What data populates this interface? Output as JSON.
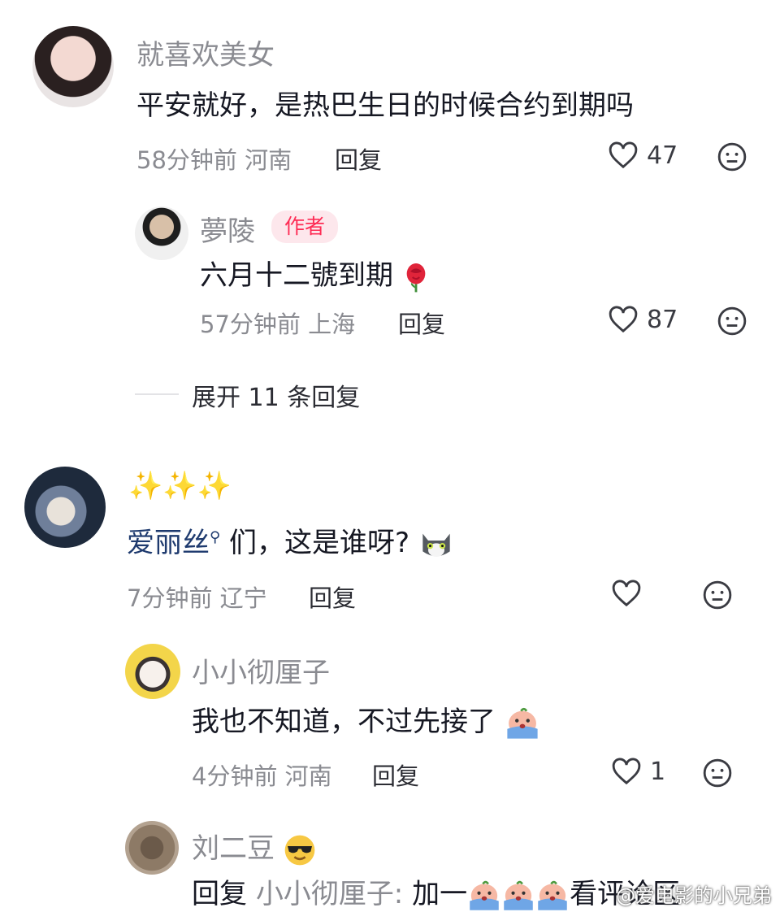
{
  "comments": [
    {
      "username": "就喜欢美女",
      "text": "平安就好，是热巴生日的时候合约到期吗",
      "time_location": "58分钟前 河南",
      "reply_label": "回复",
      "likes": "47"
    },
    {
      "username": "夢陵",
      "badge": "作者",
      "text": "六月十二號到期",
      "time_location": "57分钟前 上海",
      "reply_label": "回复",
      "likes": "87"
    },
    {
      "username": "✨✨✨",
      "mention": "爱丽丝",
      "text": "们，这是谁呀?",
      "time_location": "7分钟前 辽宁",
      "reply_label": "回复",
      "likes": ""
    },
    {
      "username": "小小彻厘子",
      "text": "我也不知道，不过先接了",
      "time_location": "4分钟前 河南",
      "reply_label": "回复",
      "likes": "1"
    },
    {
      "username": "刘二豆",
      "reply_prefix": "回复",
      "reply_target": "小小彻厘子:",
      "text": "加一",
      "text_tail": "看评论区"
    }
  ],
  "expand_replies": "展开 11 条回复",
  "watermark": "@爱电影的小兄弟",
  "colors": {
    "author_badge": "#fe2c55",
    "mention": "#1e3a6e",
    "meta": "#8a8b91"
  },
  "icons": [
    "heart-outline-icon",
    "dislike-face-icon",
    "rose-emoji",
    "cat-emoji",
    "crying-emoji",
    "sunglasses-emoji"
  ]
}
